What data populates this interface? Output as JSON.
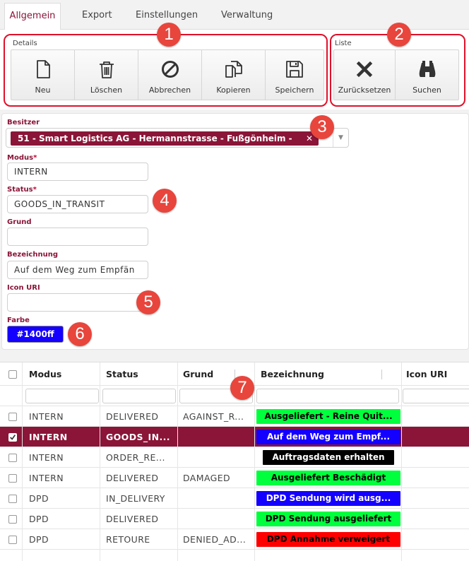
{
  "tabs": [
    "Allgemein",
    "Export",
    "Einstellungen",
    "Verwaltung"
  ],
  "toolbar": {
    "details_label": "Details",
    "liste_label": "Liste",
    "details_buttons": [
      "Neu",
      "Löschen",
      "Abbrechen",
      "Kopieren",
      "Speichern"
    ],
    "liste_buttons": [
      "Zurücksetzen",
      "Suchen"
    ]
  },
  "annotations": [
    "1",
    "2",
    "3",
    "4",
    "5",
    "6",
    "7"
  ],
  "form": {
    "besitzer_label": "Besitzer",
    "besitzer_value": "51 - Smart Logistics AG - Hermannstrasse - Fußgönheim -",
    "besitzer_clear": "✕",
    "modus_label": "Modus",
    "modus_value": "INTERN",
    "status_label": "Status",
    "status_value": "GOODS_IN_TRANSIT",
    "grund_label": "Grund",
    "grund_value": "",
    "bezeichnung_label": "Bezeichnung",
    "bezeichnung_value": "Auf dem Weg zum Empfän",
    "icon_label": "Icon URI",
    "icon_value": "",
    "farbe_label": "Farbe",
    "farbe_value": "#1400ff",
    "required_mark": "*"
  },
  "table": {
    "columns": [
      "Modus",
      "Status",
      "Grund",
      "Bezeichnung",
      "Icon URI"
    ],
    "rows": [
      {
        "modus": "INTERN",
        "status": "DELIVERED",
        "grund": "AGAINST_R...",
        "bezeichnung": "Ausgeliefert - Reine Quit...",
        "color": "#00ff3c",
        "text_color": "#000000",
        "selected": false
      },
      {
        "modus": "INTERN",
        "status": "GOODS_IN...",
        "grund": "",
        "bezeichnung": "Auf dem Weg zum Empf...",
        "color": "#1400ff",
        "text_color": "#ffffff",
        "selected": true
      },
      {
        "modus": "INTERN",
        "status": "ORDER_RE...",
        "grund": "",
        "bezeichnung": "Auftragsdaten erhalten",
        "color": "#000000",
        "text_color": "#ffffff",
        "selected": false
      },
      {
        "modus": "INTERN",
        "status": "DELIVERED",
        "grund": "DAMAGED",
        "bezeichnung": "Ausgeliefert Beschädigt",
        "color": "#00ff3c",
        "text_color": "#000000",
        "selected": false
      },
      {
        "modus": "DPD",
        "status": "IN_DELIVERY",
        "grund": "",
        "bezeichnung": "DPD Sendung wird ausg...",
        "color": "#1400ff",
        "text_color": "#ffffff",
        "selected": false
      },
      {
        "modus": "DPD",
        "status": "DELIVERED",
        "grund": "",
        "bezeichnung": "DPD Sendung ausgeliefert",
        "color": "#00ff3c",
        "text_color": "#000000",
        "selected": false
      },
      {
        "modus": "DPD",
        "status": "RETOURE",
        "grund": "DENIED_AD...",
        "bezeichnung": "DPD Annahme verweigert",
        "color": "#ff0000",
        "text_color": "#000000",
        "selected": false
      }
    ]
  }
}
